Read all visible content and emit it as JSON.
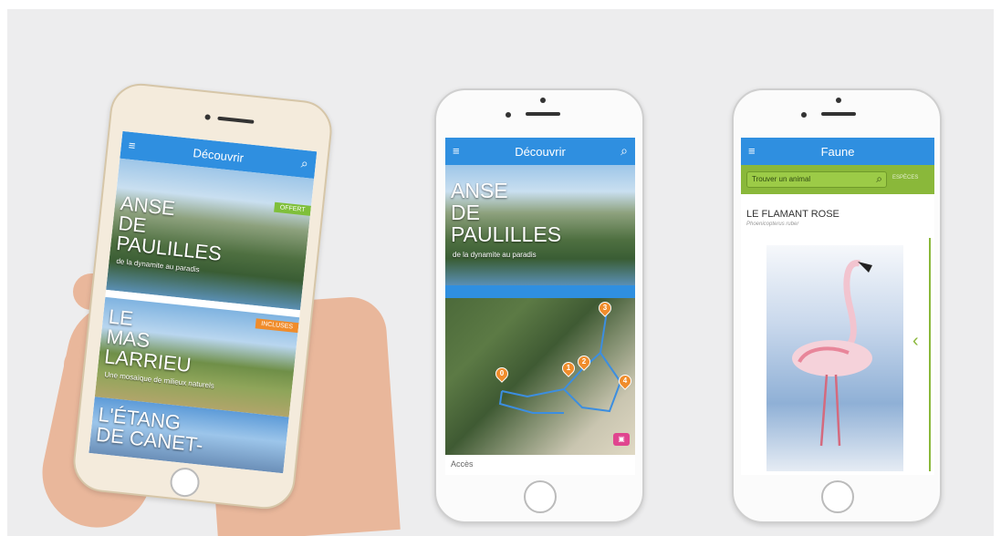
{
  "phone1": {
    "appbar": {
      "title": "Découvrir"
    },
    "cards": [
      {
        "title_lines": [
          "ANSE",
          "DE",
          "PAULILLES"
        ],
        "subtitle": "de la dynamite au paradis",
        "badge": "OFFERT"
      },
      {
        "title_lines": [
          "LE",
          "MAS",
          "LARRIEU"
        ],
        "subtitle": "Une mosaïque de milieux naturels",
        "badge": "INCLUSES"
      },
      {
        "title_lines": [
          "L'ÉTANG",
          "DE CANET-"
        ]
      }
    ]
  },
  "phone2": {
    "appbar": {
      "title": "Découvrir"
    },
    "card": {
      "title_lines": [
        "ANSE",
        "DE",
        "PAULILLES"
      ],
      "subtitle": "de la dynamite au paradis"
    },
    "map_pins": [
      "0",
      "1",
      "2",
      "3",
      "4"
    ],
    "footer_text": "Accès"
  },
  "phone3": {
    "appbar": {
      "title": "Faune"
    },
    "search": {
      "placeholder": "Trouver un animal",
      "filter": "ESPÈCES"
    },
    "species": {
      "name": "LE FLAMANT ROSE",
      "latin": "Phoenicopterus ruber"
    }
  },
  "colors": {
    "appbar": "#2f8fe0",
    "search_bar": "#8ab83a",
    "pin": "#f08c2b",
    "offert_badge": "#7fbf3a"
  }
}
